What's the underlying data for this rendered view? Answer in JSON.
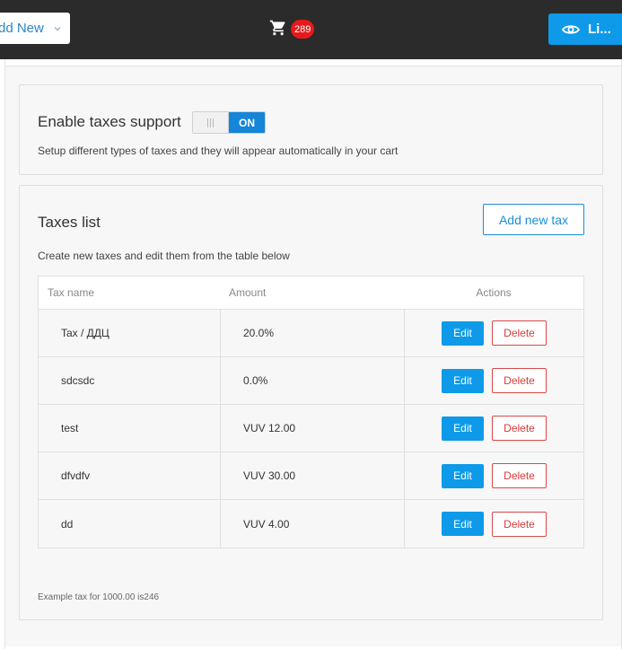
{
  "header": {
    "add_new_label": "dd New",
    "cart_count": "289",
    "live_label": "Li..."
  },
  "taxes_support": {
    "title": "Enable taxes support",
    "toggle_state": "ON",
    "description": "Setup different types of taxes and they will appear automatically in your cart"
  },
  "taxes_list": {
    "title": "Taxes list",
    "add_button": "Add new tax",
    "description": "Create new taxes and edit them from the table below",
    "columns": {
      "name": "Tax name",
      "amount": "Amount",
      "actions": "Actions"
    },
    "rows": [
      {
        "name": "Tax / ДДЦ",
        "amount": "20.0%",
        "edit": "Edit",
        "delete": "Delete"
      },
      {
        "name": "sdcsdc",
        "amount": "0.0%",
        "edit": "Edit",
        "delete": "Delete"
      },
      {
        "name": "test",
        "amount": "VUV 12.00",
        "edit": "Edit",
        "delete": "Delete"
      },
      {
        "name": "dfvdfv",
        "amount": "VUV 30.00",
        "edit": "Edit",
        "delete": "Delete"
      },
      {
        "name": "dd",
        "amount": "VUV 4.00",
        "edit": "Edit",
        "delete": "Delete"
      }
    ],
    "example_text": "Example tax for 1000.00 is246"
  },
  "colors": {
    "topbar": "#2b2b2b",
    "accent": "#0e9ae8",
    "badge": "#e51b1b",
    "danger": "#d93a3a"
  },
  "icons": {
    "cart": "cart-icon",
    "eye": "eye-icon",
    "chevron": "chevron-down-icon"
  }
}
